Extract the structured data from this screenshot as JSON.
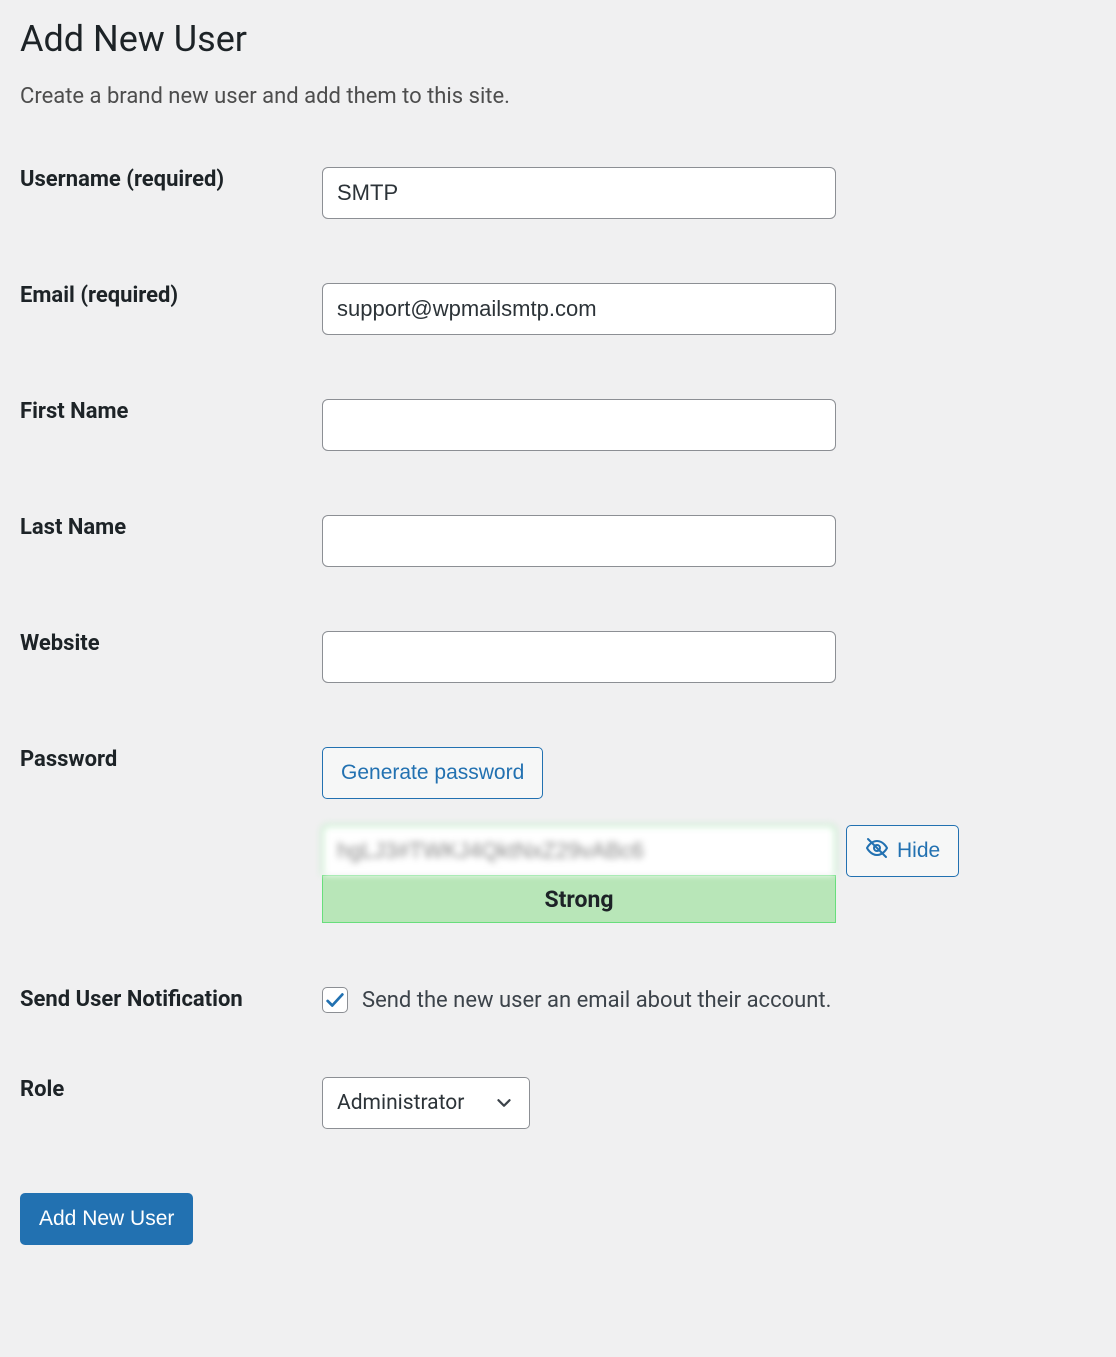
{
  "page": {
    "title": "Add New User",
    "subtitle": "Create a brand new user and add them to this site."
  },
  "labels": {
    "username": "Username (required)",
    "email": "Email (required)",
    "first_name": "First Name",
    "last_name": "Last Name",
    "website": "Website",
    "password": "Password",
    "send_notification": "Send User Notification",
    "role": "Role"
  },
  "inputs": {
    "username": "SMTP",
    "email": "support@wpmailsmtp.com",
    "first_name": "",
    "last_name": "",
    "website": "",
    "password_masked": "hgLJ3#TWKJ4QktNxZ29vABc6"
  },
  "buttons": {
    "generate_password": "Generate password",
    "hide": "Hide",
    "submit": "Add New User"
  },
  "password_strength": "Strong",
  "notification": {
    "checked": true,
    "text": "Send the new user an email about their account."
  },
  "role": {
    "selected": "Administrator"
  }
}
